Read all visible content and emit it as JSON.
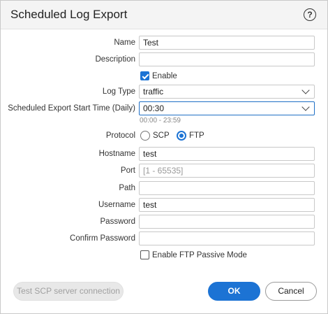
{
  "dialog": {
    "title": "Scheduled Log Export",
    "help_icon": "question-circle-icon"
  },
  "form": {
    "name": {
      "label": "Name",
      "value": "Test"
    },
    "description": {
      "label": "Description",
      "value": ""
    },
    "enable": {
      "label": "Enable",
      "checked": true
    },
    "log_type": {
      "label": "Log Type",
      "value": "traffic"
    },
    "start_time": {
      "label": "Scheduled Export Start Time (Daily)",
      "value": "00:30",
      "hint": "00:00 - 23:59"
    },
    "protocol": {
      "label": "Protocol",
      "options": [
        "SCP",
        "FTP"
      ],
      "selected": "FTP"
    },
    "hostname": {
      "label": "Hostname",
      "value": "test"
    },
    "port": {
      "label": "Port",
      "placeholder": "[1 - 65535]"
    },
    "path": {
      "label": "Path",
      "value": ""
    },
    "username": {
      "label": "Username",
      "value": "test"
    },
    "password": {
      "label": "Password",
      "value": ""
    },
    "confirm_password": {
      "label": "Confirm Password",
      "value": ""
    },
    "ftp_passive": {
      "label": "Enable FTP Passive Mode",
      "checked": false
    }
  },
  "buttons": {
    "test_label": "Test SCP server connection",
    "ok_label": "OK",
    "cancel_label": "Cancel"
  },
  "colors": {
    "accent": "#1c73d4",
    "header_bg": "#f4f4f4"
  }
}
